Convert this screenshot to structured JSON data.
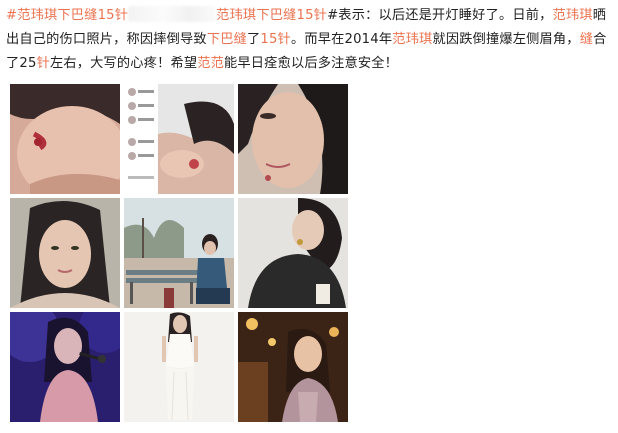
{
  "post": {
    "segments": [
      {
        "text": "#范玮琪下巴缝15针",
        "style": "link"
      },
      {
        "text": "",
        "style": "blurred"
      },
      {
        "text": "范玮琪下巴缝15针",
        "style": "link"
      },
      {
        "text": "#表示：以后还是开灯睡好了。日前，",
        "style": "plain"
      },
      {
        "text": "范玮琪",
        "style": "highlight"
      },
      {
        "text": "晒出自己的伤口照片，称因摔倒导致",
        "style": "plain"
      },
      {
        "text": "下巴缝",
        "style": "highlight"
      },
      {
        "text": "了",
        "style": "plain"
      },
      {
        "text": "15针",
        "style": "highlight"
      },
      {
        "text": "。而早在2014年",
        "style": "plain"
      },
      {
        "text": "范玮琪",
        "style": "highlight"
      },
      {
        "text": "就因跌倒撞爆左侧眉角，",
        "style": "plain"
      },
      {
        "text": "缝",
        "style": "highlight"
      },
      {
        "text": "合了25",
        "style": "plain"
      },
      {
        "text": "针",
        "style": "highlight"
      },
      {
        "text": "左右，大写的心疼！希望",
        "style": "plain"
      },
      {
        "text": "范范",
        "style": "highlight"
      },
      {
        "text": "能早日痊愈以后多注意安全！",
        "style": "plain"
      }
    ]
  },
  "photos": [
    {
      "name": "photo-chin-wound-closeup"
    },
    {
      "name": "photo-instagram-comment-screenshot"
    },
    {
      "name": "photo-chin-wound-selfie"
    },
    {
      "name": "photo-selfie-no-makeup"
    },
    {
      "name": "photo-sitting-on-bench"
    },
    {
      "name": "photo-black-outfit-portrait"
    },
    {
      "name": "photo-singing-on-stage"
    },
    {
      "name": "photo-white-dress-full-body"
    },
    {
      "name": "photo-evening-street-portrait"
    }
  ],
  "colors": {
    "link": "#eb7350",
    "text": "#222222",
    "background": "#ffffff"
  }
}
